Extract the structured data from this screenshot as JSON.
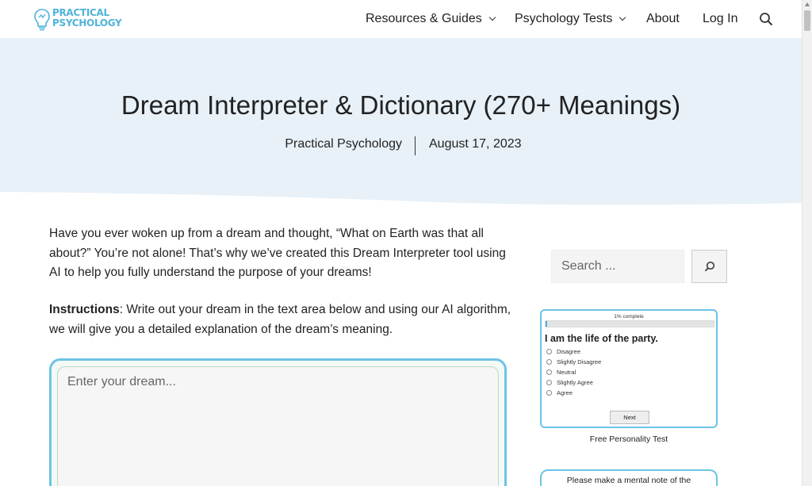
{
  "header": {
    "logo_text_line1": "PRACTICAL",
    "logo_text_line2": "PSYCHOLOGY",
    "nav": {
      "resources": "Resources & Guides",
      "tests": "Psychology Tests",
      "about": "About",
      "login": "Log In"
    },
    "icons": {
      "search": "search-icon",
      "chevron": "chevron-down-icon"
    }
  },
  "hero": {
    "title": "Dream Interpreter & Dictionary (270+ Meanings)",
    "author": "Practical Psychology",
    "date": "August 17, 2023"
  },
  "article": {
    "intro": "Have you ever woken up from a dream and thought, “What on Earth was that all about?” You’re not alone! That’s why we’ve created this Dream Interpreter tool using AI to help you fully understand the purpose of your dreams!",
    "instructions_label": "Instructions",
    "instructions_text": ": Write out your dream in the text area below and using our AI algorithm, we will give you a detailed explanation of the dream’s meaning.",
    "dream_placeholder": "Enter your dream..."
  },
  "sidebar": {
    "search_placeholder": "Search ...",
    "quiz": {
      "progress_label": "1% complete",
      "progress_fraction": 0.01,
      "question": "I am the life of the party.",
      "options": [
        "Disagree",
        "Slightly Disagree",
        "Neutral",
        "Slightly Agree",
        "Agree"
      ],
      "next_label": "Next"
    },
    "quiz_caption": "Free Personality Test",
    "note_text": "Please make a mental note of the"
  },
  "colors": {
    "accent": "#6cc4e6",
    "hero_bg": "#e8f1f8",
    "logo": "#4fb3d9"
  }
}
